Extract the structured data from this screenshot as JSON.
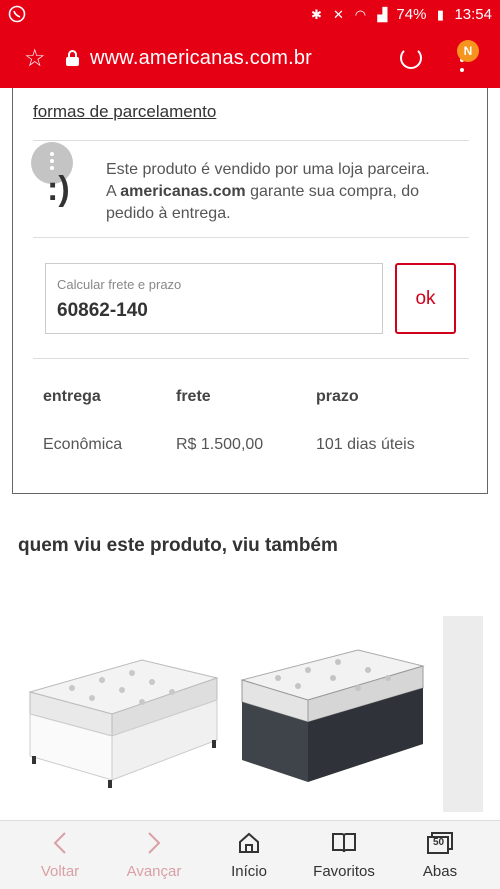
{
  "status_bar": {
    "battery": "74%",
    "time": "13:54",
    "icons": [
      "whatsapp-icon",
      "bluetooth-icon",
      "mute-icon",
      "wifi-icon",
      "signal-icon",
      "battery-icon"
    ]
  },
  "browser": {
    "url": "www.americanas.com.br",
    "profile_badge": "N",
    "icons": [
      "star-icon",
      "lock-icon",
      "reload-icon",
      "menu-icon"
    ]
  },
  "product_card": {
    "installment_link": "formas de parcelamento",
    "seller_notice_line1": "Este produto é vendido por uma loja parceira.",
    "seller_notice_brand": "americanas.com",
    "seller_notice_prefix": "A ",
    "seller_notice_rest": " garante sua compra, do pedido à entrega.",
    "freight": {
      "label": "Calcular frete e prazo",
      "value": "60862-140",
      "button": "ok"
    },
    "shipping_table": {
      "headers": [
        "entrega",
        "frete",
        "prazo"
      ],
      "rows": [
        [
          "Econômica",
          "R$ 1.500,00",
          "101 dias úteis"
        ]
      ]
    }
  },
  "recommendations": {
    "title": "quem viu este produto, viu também"
  },
  "bottom_nav": {
    "items": [
      {
        "label": "Voltar",
        "icon": "chevron-left-icon"
      },
      {
        "label": "Avançar",
        "icon": "chevron-right-icon"
      },
      {
        "label": "Início",
        "icon": "home-icon"
      },
      {
        "label": "Favoritos",
        "icon": "book-icon"
      },
      {
        "label": "Abas",
        "icon": "tabs-icon",
        "count": "50"
      }
    ]
  },
  "colors": {
    "brand_red": "#e60014",
    "button_red": "#d0021b"
  }
}
